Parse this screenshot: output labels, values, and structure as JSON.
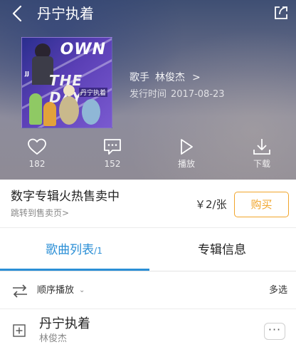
{
  "header": {
    "title": "丹宁执着"
  },
  "album": {
    "artist_label": "歌手",
    "artist_name": "林俊杰",
    "artist_chevron": ">",
    "release_label": "发行时间",
    "release_date": "2017-08-23",
    "cover_text_top": "OWN",
    "cover_text_main": "THE DAY",
    "cover_text_jj": "JJ",
    "cover_text_cn": "丹宁执着"
  },
  "actions": [
    {
      "name": "like",
      "label": "182",
      "icon": "heart-icon"
    },
    {
      "name": "comment",
      "label": "152",
      "icon": "comment-icon"
    },
    {
      "name": "play",
      "label": "播放",
      "icon": "play-icon"
    },
    {
      "name": "download",
      "label": "下载",
      "icon": "download-icon"
    }
  ],
  "purchase": {
    "title": "数字专辑火热售卖中",
    "subtitle": "跳转到售卖页>",
    "price": "￥2/张",
    "buy_label": "购买",
    "accent": "#f1a52b"
  },
  "tabs": {
    "songs_label": "歌曲列表",
    "songs_count": "/1",
    "info_label": "专辑信息",
    "accent": "#2b8fd6"
  },
  "toolbar": {
    "order_label": "顺序播放",
    "order_caret": "⌄",
    "multi_select": "多选"
  },
  "songs": [
    {
      "title": "丹宁执着",
      "artist": "林俊杰",
      "more": "···"
    }
  ]
}
